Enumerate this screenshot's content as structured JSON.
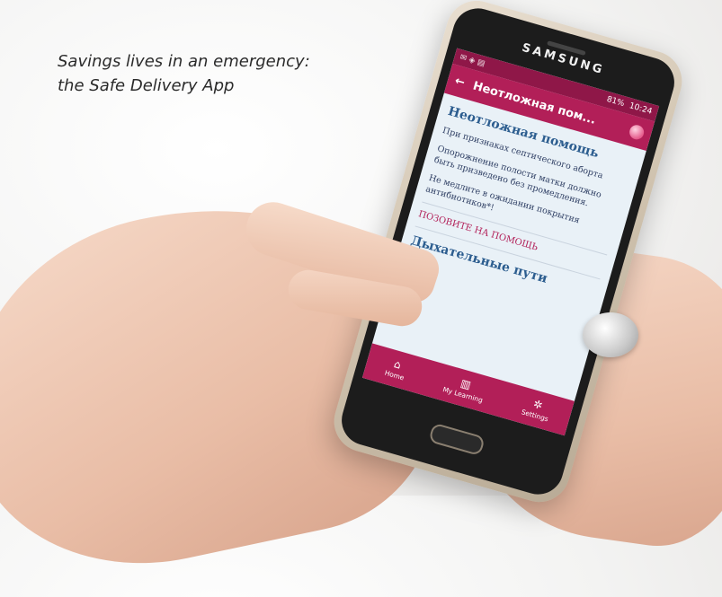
{
  "caption": {
    "line1": "Savings lives in an emergency:",
    "line2": "the Safe Delivery App"
  },
  "phone": {
    "brand": "SAMSUNG",
    "statusbar": {
      "signal": "81%",
      "time": "10:24"
    },
    "appbar": {
      "back_icon": "arrow-left-icon",
      "title": "Неотложная пом...",
      "logo_icon": "app-logo-icon"
    },
    "content": {
      "heading": "Неотложная помощь",
      "paragraphs": [
        "При признаках септического аборта",
        "Опорожнение полости матки должно быть призведено без промедления.",
        "Не медлите в ожидании покрытия антибиотиков*!"
      ],
      "callout": "ПОЗОВИТЕ НА ПОМОЩЬ",
      "next_heading": "Дыхательные пути"
    },
    "bottom_nav": [
      {
        "label": "Home",
        "icon": "home-icon"
      },
      {
        "label": "My Learning",
        "icon": "book-icon"
      },
      {
        "label": "Settings",
        "icon": "gear-icon"
      }
    ]
  },
  "colors": {
    "app_primary": "#b21f58",
    "statusbar": "#8f1748",
    "screen_bg": "#e9f1f7",
    "heading": "#2c5d8f"
  }
}
